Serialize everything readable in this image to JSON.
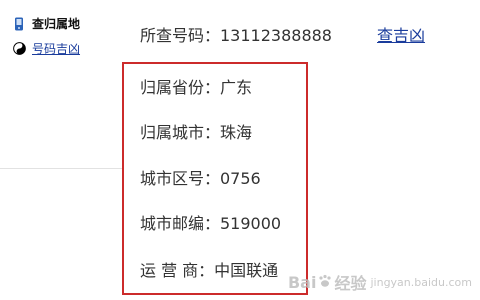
{
  "sidebar": {
    "items": [
      {
        "label": "查归属地",
        "icon": "phone-icon"
      },
      {
        "label": "号码吉凶",
        "icon": "yin-yang-icon"
      }
    ]
  },
  "query": {
    "label": "所查号码：13112388888",
    "link": "查吉凶"
  },
  "result": {
    "province": "归属省份：广东",
    "city": "归属城市：珠海",
    "area_code": "城市区号：0756",
    "postal_code": "城市邮编：519000",
    "carrier": "运 营 商：中国联通"
  },
  "watermark": {
    "brand_left": "Bai",
    "brand_right": "经验",
    "url": "jingyan.baidu.com"
  },
  "colors": {
    "link": "#1a3c9c",
    "highlight_border": "#cc2b2b",
    "text": "#333333"
  }
}
